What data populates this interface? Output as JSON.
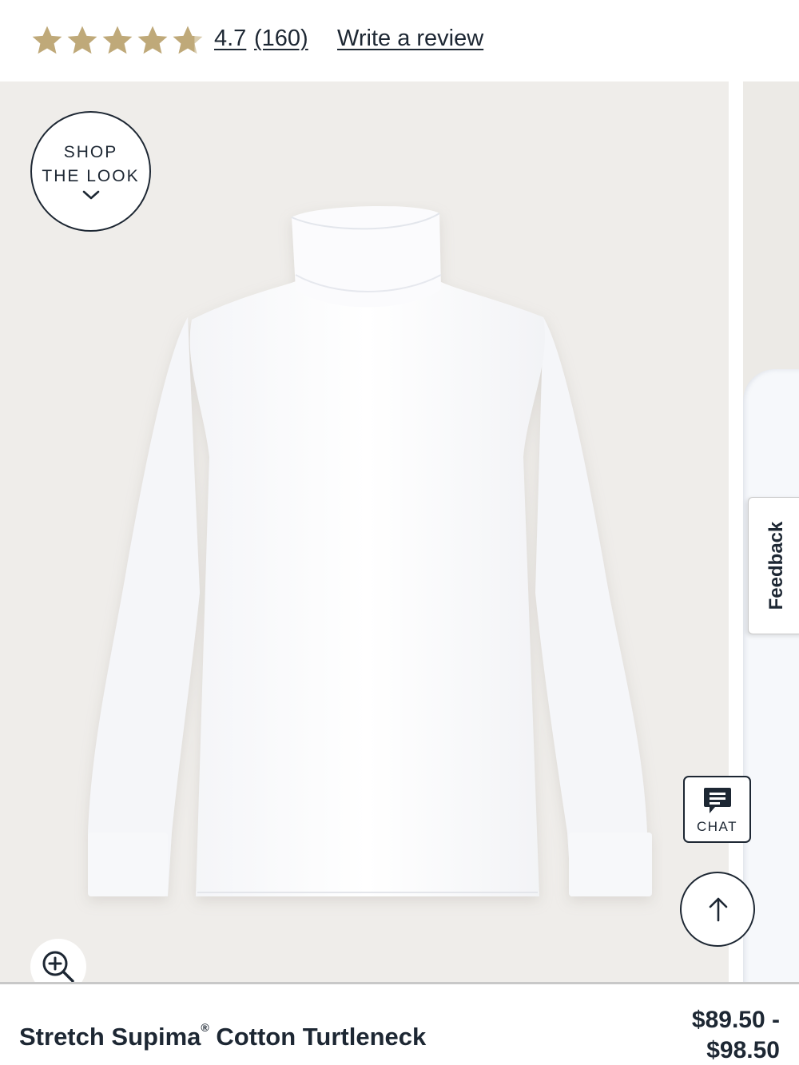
{
  "rating": {
    "stars_value": 4.7,
    "star_color": "#bfa979",
    "value_text": "4.7",
    "count_text": "(160)",
    "write_review": "Write a review"
  },
  "gallery": {
    "shop_the_look": {
      "line1": "SHOP",
      "line2": "THE LOOK",
      "icon": "chevron-down-icon"
    },
    "zoom_icon": "zoom-in-icon",
    "feedback_label": "Feedback",
    "chat_label": "CHAT",
    "back_to_top_icon": "arrow-up-icon",
    "image_alt": "White Stretch Supima Cotton Turtleneck"
  },
  "product": {
    "name_part1": "Stretch Supima",
    "registered_mark": "®",
    "name_part2": " Cotton Turtleneck",
    "price_line1": "$89.50 -",
    "price_line2": "$98.50"
  },
  "colors": {
    "text": "#1d2733",
    "image_bg": "#efedea",
    "star": "#bfa979"
  }
}
